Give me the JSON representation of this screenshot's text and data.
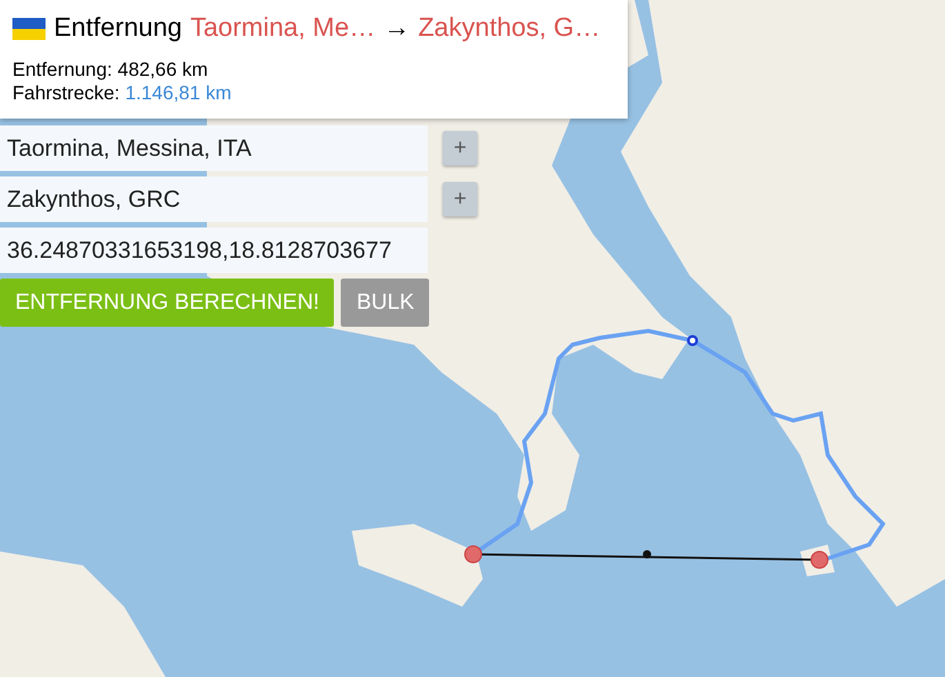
{
  "header": {
    "title": "Entfernung",
    "origin": "Taormina, Me…",
    "arrow": "→",
    "destination": "Zakynthos, G…"
  },
  "stats": [
    {
      "label": "Entfernung:",
      "value": "482,66 km",
      "kind": "plain"
    },
    {
      "label": "Fahrstrecke:",
      "value": "1.146,81 km",
      "kind": "link"
    }
  ],
  "fields": [
    {
      "value": "Taormina, Messina, ITA",
      "add": "+"
    },
    {
      "value": "Zakynthos, GRC",
      "add": "+"
    },
    {
      "value": "36.24870331653198,18.8128703677"
    }
  ],
  "buttons": [
    {
      "label": "ENTFERNUNG BERECHNEN!",
      "kind": "primary"
    },
    {
      "label": "BULK",
      "kind": "secondary"
    }
  ]
}
